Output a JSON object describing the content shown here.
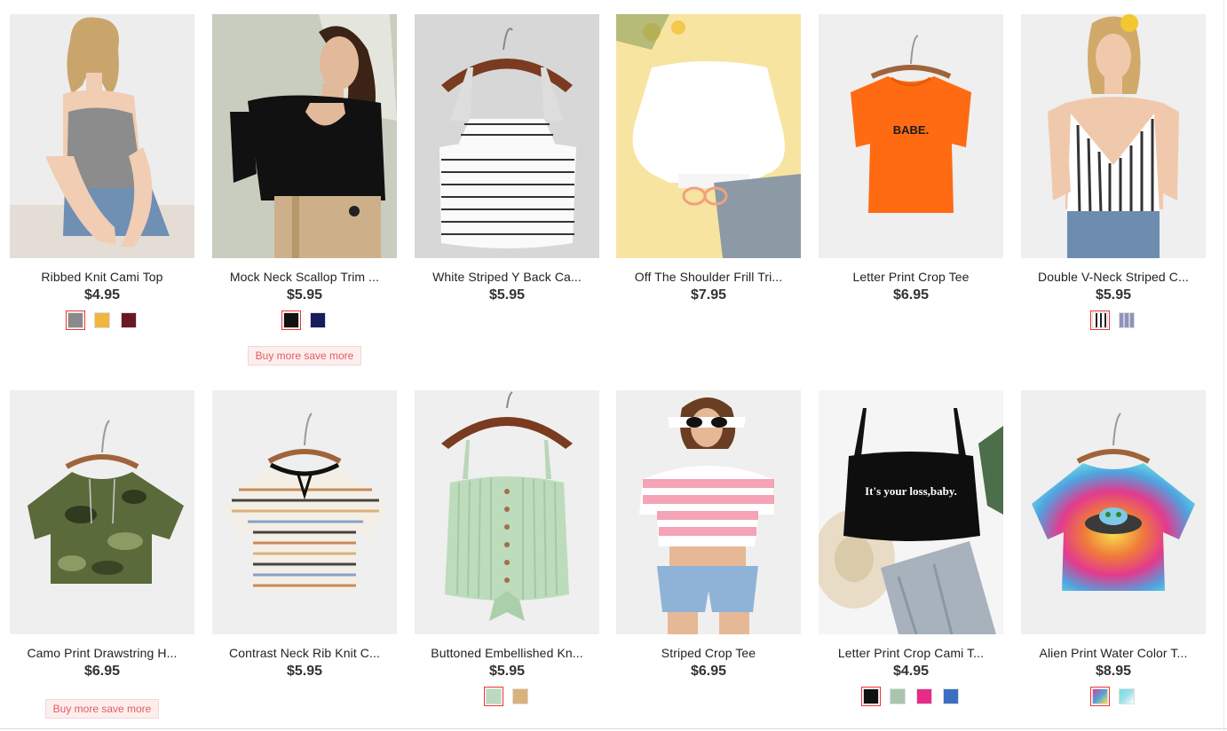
{
  "products": [
    {
      "name": "Ribbed Knit Cami Top",
      "price": "$4.95",
      "swatches": [
        "#8a8a8a",
        "#f0b63f",
        "#6b1720"
      ],
      "selected_swatch": 0,
      "promo": "",
      "image_icon": "woman-grey-cami-photo"
    },
    {
      "name": "Mock Neck Scallop Trim ...",
      "price": "$5.95",
      "swatches": [
        "#111111",
        "#1a1a5e"
      ],
      "selected_swatch": 0,
      "promo": "Buy more save more",
      "image_icon": "woman-black-scallop-top-photo"
    },
    {
      "name": "White Striped Y Back Ca...",
      "price": "$5.95",
      "swatches": [],
      "selected_swatch": -1,
      "promo": "",
      "image_icon": "striped-cami-hanger-photo"
    },
    {
      "name": "Off The Shoulder Frill Tri...",
      "price": "$7.95",
      "swatches": [],
      "selected_swatch": -1,
      "promo": "",
      "image_icon": "white-off-shoulder-top-flatlay-photo"
    },
    {
      "name": "Letter Print Crop Tee",
      "price": "$6.95",
      "swatches": [],
      "selected_swatch": -1,
      "promo": "",
      "image_icon": "orange-babe-tee-photo",
      "print_text": "BABE."
    },
    {
      "name": "Double V-Neck Striped C...",
      "price": "$5.95",
      "swatches": [
        "#ffffff",
        "#8e94b8"
      ],
      "selected_swatch": 0,
      "promo": "",
      "image_icon": "woman-striped-cami-photo"
    },
    {
      "name": "Camo Print Drawstring H...",
      "price": "$6.95",
      "swatches": [],
      "selected_swatch": -1,
      "promo": "Buy more save more",
      "image_icon": "camo-hooded-tee-photo"
    },
    {
      "name": "Contrast Neck Rib Knit C...",
      "price": "$5.95",
      "swatches": [],
      "selected_swatch": -1,
      "promo": "",
      "image_icon": "striped-rib-knit-tee-photo"
    },
    {
      "name": "Buttoned Embellished Kn...",
      "price": "$5.95",
      "swatches": [
        "#bcd9bd",
        "#d9b27a"
      ],
      "selected_swatch": 0,
      "promo": "",
      "image_icon": "mint-knit-cami-photo"
    },
    {
      "name": "Striped Crop Tee",
      "price": "$6.95",
      "swatches": [],
      "selected_swatch": -1,
      "promo": "",
      "image_icon": "woman-pink-striped-tee-photo"
    },
    {
      "name": "Letter Print Crop Cami T...",
      "price": "$4.95",
      "swatches": [
        "#111111",
        "#a9c5ae",
        "#e82a8a",
        "#3a6fc2"
      ],
      "selected_swatch": 0,
      "promo": "",
      "image_icon": "black-cami-flatlay-photo",
      "print_text": "It's your loss,baby."
    },
    {
      "name": "Alien Print Water Color T...",
      "price": "$8.95",
      "swatches": [
        "#7fa8e0",
        "#9fe0e8"
      ],
      "selected_swatch": 0,
      "promo": "",
      "image_icon": "tie-dye-alien-tee-photo"
    }
  ]
}
